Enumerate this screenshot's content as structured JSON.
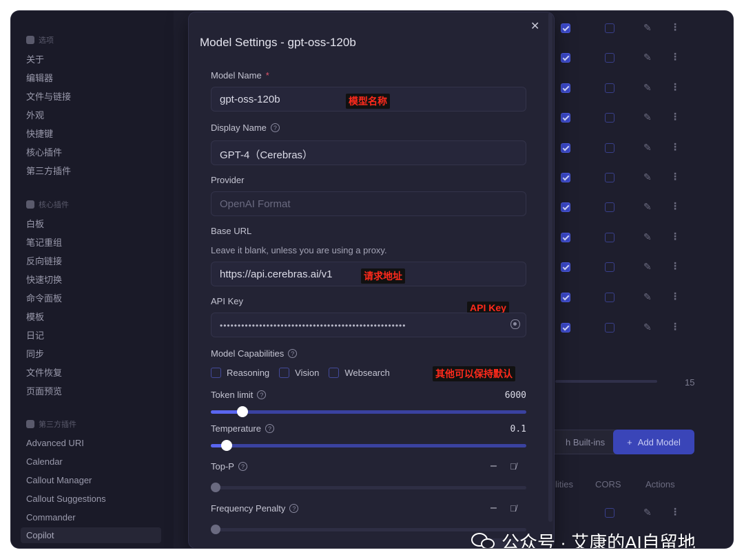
{
  "sidebar": {
    "section_options": "选项",
    "options_items": [
      "关于",
      "编辑器",
      "文件与链接",
      "外观",
      "快捷键",
      "核心插件",
      "第三方插件"
    ],
    "section_core": "核心插件",
    "core_items": [
      "白板",
      "笔记重组",
      "反向链接",
      "快速切换",
      "命令面板",
      "模板",
      "日记",
      "同步",
      "文件恢复",
      "页面预览"
    ],
    "section_third": "第三方插件",
    "third_items": [
      "Advanced URI",
      "Calendar",
      "Callout Manager",
      "Callout Suggestions",
      "Commander",
      "Copilot"
    ]
  },
  "background": {
    "slider_value": "15",
    "builtins_button": "h Built-ins",
    "add_model_button": "Add Model",
    "col_capabilities": "lities",
    "col_cors": "CORS",
    "col_actions": "Actions"
  },
  "modal": {
    "title": "Model Settings - gpt-oss-120b",
    "model_name_label": "Model Name",
    "required_mark": "*",
    "model_name_value": "gpt-oss-120b",
    "display_name_label": "Display Name",
    "display_name_value": "GPT-4（Cerebras）",
    "provider_label": "Provider",
    "provider_value": "OpenAI Format",
    "base_url_label": "Base URL",
    "base_url_help": "Leave it blank, unless you are using a proxy.",
    "base_url_value": "https://api.cerebras.ai/v1",
    "api_key_label": "API Key",
    "api_key_value": "••••••••••••••••••••••••••••••••••••••••••••••••••••",
    "capabilities_label": "Model Capabilities",
    "capabilities": [
      "Reasoning",
      "Vision",
      "Websearch"
    ],
    "token_limit_label": "Token limit",
    "token_limit_value": "6000",
    "token_limit_fraction": 0.1,
    "temperature_label": "Temperature",
    "temperature_value": "0.1",
    "temperature_fraction": 0.05,
    "top_p_label": "Top-P",
    "top_p_value": "–",
    "frequency_penalty_label": "Frequency Penalty",
    "frequency_penalty_value": "–"
  },
  "annotations": {
    "model_name": "模型名称",
    "base_url": "请求地址",
    "api_key": "API Key",
    "others": "其他可以保持默认"
  },
  "watermark": {
    "text": "公众号 · 艾康的AI自留地"
  },
  "colors": {
    "accent": "#5a66f0",
    "annotation_text": "#ff2a1c",
    "required": "#e0556a"
  }
}
